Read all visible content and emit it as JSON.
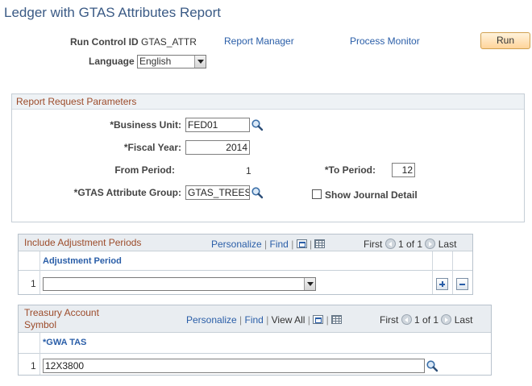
{
  "page": {
    "title": "Ledger with GTAS Attributes Report"
  },
  "run_control": {
    "id_label": "Run Control ID",
    "id_value": "GTAS_ATTR",
    "report_manager": "Report Manager",
    "process_monitor": "Process Monitor",
    "run_label": "Run",
    "language_label": "Language",
    "language_value": "English"
  },
  "params": {
    "header": "Report Request Parameters",
    "business_unit_label": "*Business Unit:",
    "business_unit_value": "FED01",
    "fiscal_year_label": "*Fiscal Year:",
    "fiscal_year_value": "2014",
    "from_period_label": "From Period:",
    "from_period_value": "1",
    "to_period_label": "*To Period:",
    "to_period_value": "12",
    "gtas_group_label": "*GTAS Attribute Group:",
    "gtas_group_value": "GTAS_TREES",
    "show_journal_label": "Show Journal Detail"
  },
  "adjust_grid": {
    "title": "Include Adjustment Periods",
    "personalize": "Personalize",
    "find": "Find",
    "first": "First",
    "range": "1 of 1",
    "last": "Last",
    "col_header": "Adjustment Period",
    "rows": [
      {
        "num": "1",
        "value": ""
      }
    ]
  },
  "tas_grid": {
    "title_line1": "Treasury Account",
    "title_line2": "Symbol",
    "personalize": "Personalize",
    "find": "Find",
    "view_all": "View All",
    "first": "First",
    "range": "1 of 1",
    "last": "Last",
    "col_header": "*GWA TAS",
    "rows": [
      {
        "num": "1",
        "value": "12X3800"
      }
    ]
  },
  "colors": {
    "title": "#3a5a85",
    "link": "#2a5ea8",
    "section_header": "#9c4b2a",
    "run_button": "#ffd49a"
  },
  "icons": [
    "magnifier-icon",
    "chevron-down-icon",
    "popup-icon",
    "spreadsheet-icon",
    "arrow-left-icon",
    "arrow-right-icon",
    "plus-icon",
    "minus-icon"
  ]
}
